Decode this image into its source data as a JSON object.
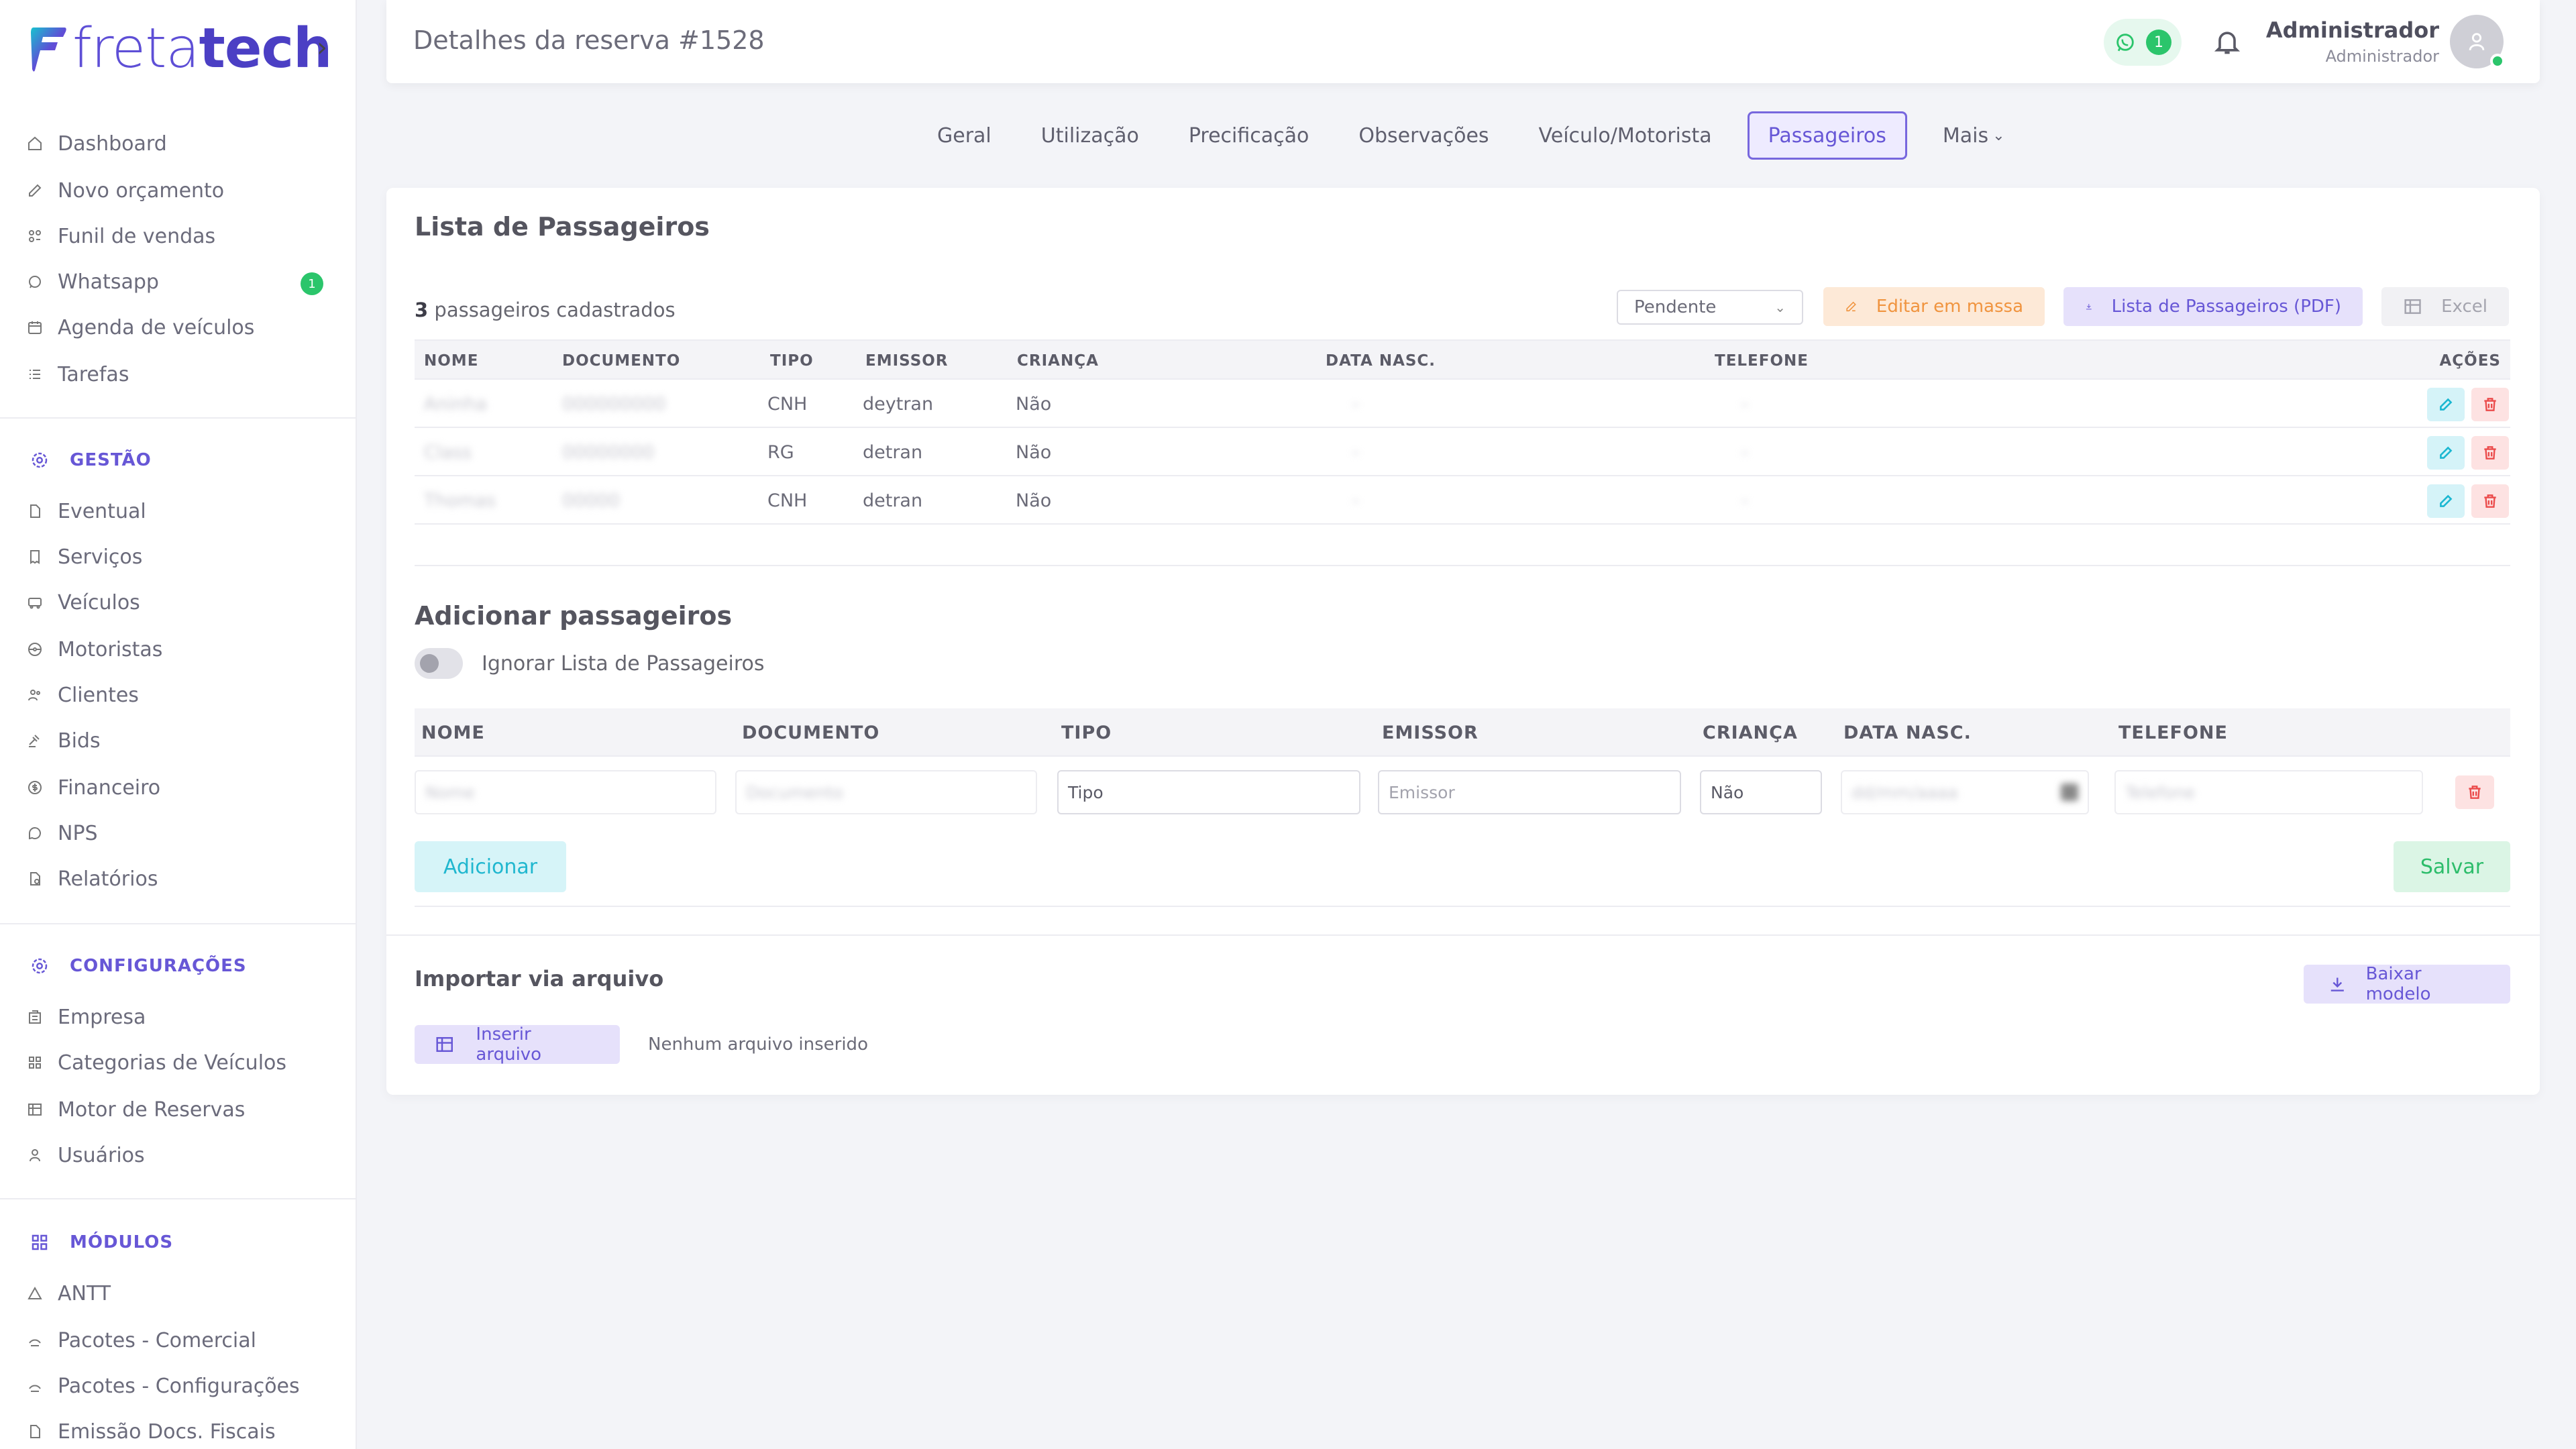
{
  "brand": {
    "name_light": "freta",
    "name_bold": "tech",
    "accent": "#6757d6"
  },
  "sidebar": {
    "main_items": [
      {
        "label": "Dashboard",
        "icon": "home-icon"
      },
      {
        "label": "Novo orçamento",
        "icon": "edit-icon"
      },
      {
        "label": "Funil de vendas",
        "icon": "funnel-icon"
      },
      {
        "label": "Whatsapp",
        "icon": "whatsapp-icon",
        "badge": "1"
      },
      {
        "label": "Agenda de veículos",
        "icon": "calendar-icon"
      },
      {
        "label": "Tarefas",
        "icon": "list-icon"
      }
    ],
    "gestao": {
      "title": "GESTÃO",
      "items": [
        {
          "label": "Eventual",
          "icon": "document-icon"
        },
        {
          "label": "Serviços",
          "icon": "receipt-icon"
        },
        {
          "label": "Veículos",
          "icon": "bus-icon"
        },
        {
          "label": "Motoristas",
          "icon": "steering-wheel-icon"
        },
        {
          "label": "Clientes",
          "icon": "users-icon"
        },
        {
          "label": "Bids",
          "icon": "gavel-icon"
        },
        {
          "label": "Financeiro",
          "icon": "dollar-icon"
        },
        {
          "label": "NPS",
          "icon": "chat-icon"
        },
        {
          "label": "Relatórios",
          "icon": "report-icon"
        }
      ]
    },
    "configuracoes": {
      "title": "CONFIGURAÇÕES",
      "items": [
        {
          "label": "Empresa",
          "icon": "building-icon"
        },
        {
          "label": "Categorias de Veículos",
          "icon": "grid-icon"
        },
        {
          "label": "Motor de Reservas",
          "icon": "table-icon"
        },
        {
          "label": "Usuários",
          "icon": "user-icon"
        }
      ]
    },
    "modulos": {
      "title": "MÓDULOS",
      "items": [
        {
          "label": "ANTT",
          "icon": "triangle-icon"
        },
        {
          "label": "Pacotes - Comercial",
          "icon": "package-icon"
        },
        {
          "label": "Pacotes - Configurações",
          "icon": "package-icon"
        },
        {
          "label": "Emissão Docs. Fiscais",
          "icon": "document-icon"
        }
      ]
    }
  },
  "header": {
    "title": "Detalhes da reserva #1528",
    "whatsapp_count": "1",
    "user_name": "Administrador",
    "user_role": "Administrador"
  },
  "tabs": [
    {
      "label": "Geral"
    },
    {
      "label": "Utilização"
    },
    {
      "label": "Precificação"
    },
    {
      "label": "Observações"
    },
    {
      "label": "Veículo/Motorista"
    },
    {
      "label": "Passageiros",
      "active": true
    },
    {
      "label": "Mais"
    }
  ],
  "passenger_list": {
    "title": "Lista de Passageiros",
    "count": "3",
    "count_suffix": "passageiros cadastrados",
    "status_select": "Pendente",
    "btn_bulk_edit": "Editar em massa",
    "btn_pdf": "Lista de Passageiros (PDF)",
    "btn_excel": "Excel",
    "columns": [
      "NOME",
      "DOCUMENTO",
      "TIPO",
      "EMISSOR",
      "CRIANÇA",
      "DATA NASC.",
      "TELEFONE",
      "AÇÕES"
    ],
    "rows": [
      {
        "nome": "Aninha",
        "documento": "000000000",
        "tipo": "CNH",
        "emissor": "deytran",
        "crianca": "Não",
        "data_nasc": "-",
        "telefone": "-"
      },
      {
        "nome": "Class",
        "documento": "00000000",
        "tipo": "RG",
        "emissor": "detran",
        "crianca": "Não",
        "data_nasc": "-",
        "telefone": "-"
      },
      {
        "nome": "Thomas",
        "documento": "00000",
        "tipo": "CNH",
        "emissor": "detran",
        "crianca": "Não",
        "data_nasc": "-",
        "telefone": "-"
      }
    ]
  },
  "add_passengers": {
    "title": "Adicionar passageiros",
    "toggle_label": "Ignorar Lista de Passageiros",
    "columns": [
      "NOME",
      "DOCUMENTO",
      "TIPO",
      "EMISSOR",
      "CRIANÇA",
      "DATA NASC.",
      "TELEFONE"
    ],
    "inputs": {
      "nome_placeholder": "Nome",
      "documento_placeholder": "Documento",
      "tipo_value": "Tipo",
      "emissor_placeholder": "Emissor",
      "crianca_value": "Não",
      "data_nasc_placeholder": "dd/mm/aaaa",
      "telefone_placeholder": "Telefone"
    },
    "btn_add": "Adicionar",
    "btn_save": "Salvar"
  },
  "import": {
    "title": "Importar via arquivo",
    "btn_template": "Baixar modelo",
    "btn_insert": "Inserir arquivo",
    "status": "Nenhum arquivo inserido"
  }
}
